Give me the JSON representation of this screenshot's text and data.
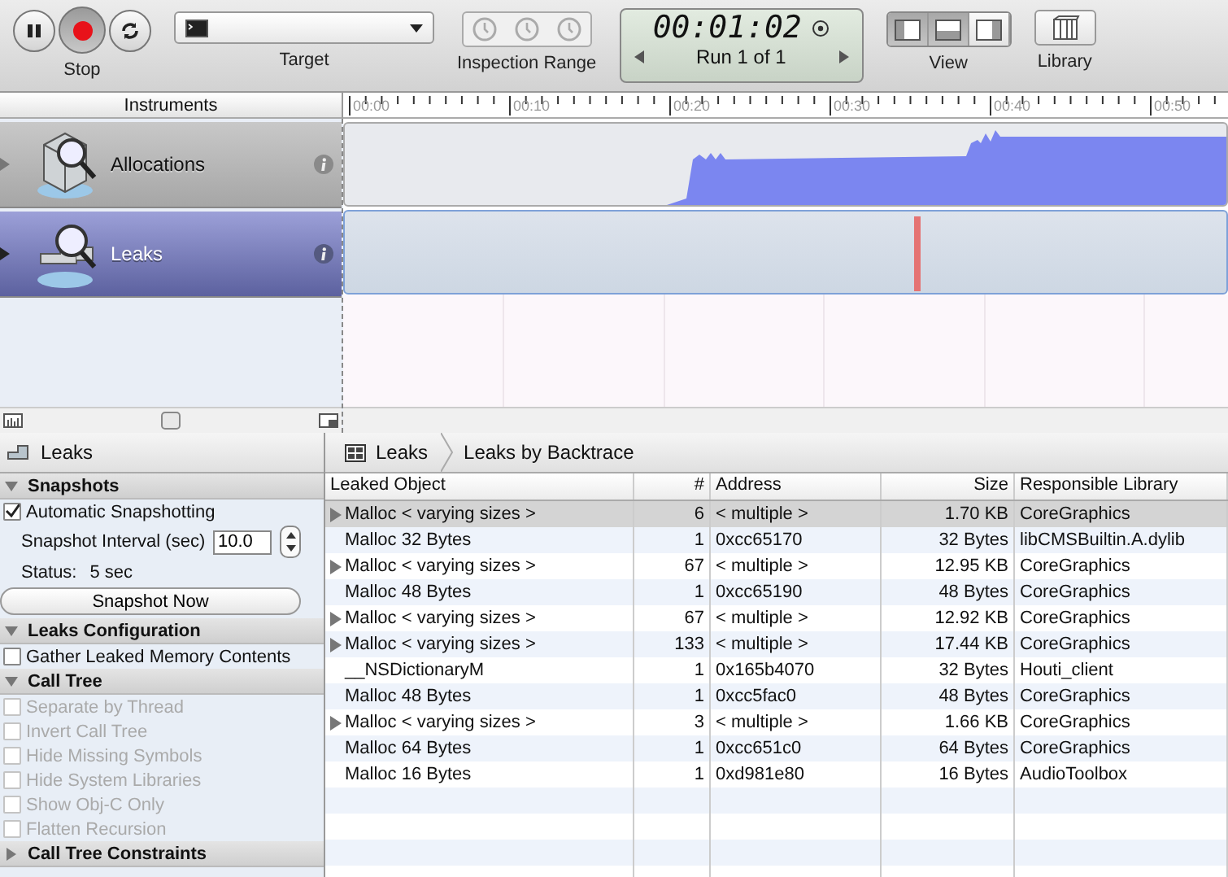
{
  "toolbar": {
    "record": {
      "label": "Stop",
      "recording": true
    },
    "target": {
      "label": "Target"
    },
    "inspection": {
      "label": "Inspection Range"
    },
    "timer": {
      "time": "00:01:02",
      "run": "Run 1 of 1"
    },
    "view": {
      "label": "View",
      "buttons": [
        {
          "selected": true
        },
        {
          "selected": true
        },
        {
          "selected": false
        }
      ]
    },
    "library": {
      "label": "Library"
    }
  },
  "timeline": {
    "header": "Instruments",
    "ruler": [
      "00:00",
      "00:10",
      "00:20",
      "00:30",
      "00:40",
      "00:50"
    ],
    "tracks": [
      {
        "name": "Allocations",
        "kind": "allocations",
        "selected": false
      },
      {
        "name": "Leaks",
        "kind": "leaks",
        "selected": true
      }
    ]
  },
  "detail": {
    "title": "Leaks",
    "breadcrumbs": [
      "Leaks",
      "Leaks by Backtrace"
    ]
  },
  "sections": [
    {
      "title": "Snapshots",
      "expanded": true,
      "items": [
        {
          "kind": "checkbox",
          "label": "Automatic Snapshotting",
          "checked": true,
          "disabled": false
        },
        {
          "kind": "number",
          "label": "Snapshot Interval (sec)",
          "value": "10.0"
        },
        {
          "kind": "status",
          "label": "Status:",
          "value": "5 sec"
        },
        {
          "kind": "button",
          "label": "Snapshot Now"
        }
      ]
    },
    {
      "title": "Leaks Configuration",
      "expanded": true,
      "items": [
        {
          "kind": "checkbox",
          "label": "Gather Leaked Memory Contents",
          "checked": false,
          "disabled": false
        }
      ]
    },
    {
      "title": "Call Tree",
      "expanded": true,
      "items": [
        {
          "kind": "checkbox",
          "label": "Separate by Thread",
          "checked": false,
          "disabled": true
        },
        {
          "kind": "checkbox",
          "label": "Invert Call Tree",
          "checked": false,
          "disabled": true
        },
        {
          "kind": "checkbox",
          "label": "Hide Missing Symbols",
          "checked": false,
          "disabled": true
        },
        {
          "kind": "checkbox",
          "label": "Hide System Libraries",
          "checked": false,
          "disabled": true
        },
        {
          "kind": "checkbox",
          "label": "Show Obj-C Only",
          "checked": false,
          "disabled": true
        },
        {
          "kind": "checkbox",
          "label": "Flatten Recursion",
          "checked": false,
          "disabled": true
        }
      ]
    },
    {
      "title": "Call Tree Constraints",
      "expanded": false
    }
  ],
  "table": {
    "columns": [
      "Leaked Object",
      "#",
      "Address",
      "Size",
      "Responsible Library"
    ],
    "rows": [
      {
        "cells": [
          "Malloc < varying sizes >",
          "6",
          "< multiple >",
          "1.70 KB",
          "CoreGraphics"
        ],
        "expandable": true,
        "selected": true
      },
      {
        "cells": [
          "Malloc 32 Bytes",
          "1",
          "0xcc65170",
          "32 Bytes",
          "libCMSBuiltin.A.dylib"
        ],
        "expandable": false,
        "selected": false
      },
      {
        "cells": [
          "Malloc < varying sizes >",
          "67",
          "< multiple >",
          "12.95 KB",
          "CoreGraphics"
        ],
        "expandable": true,
        "selected": false
      },
      {
        "cells": [
          "Malloc 48 Bytes",
          "1",
          "0xcc65190",
          "48 Bytes",
          "CoreGraphics"
        ],
        "expandable": false,
        "selected": false
      },
      {
        "cells": [
          "Malloc < varying sizes >",
          "67",
          "< multiple >",
          "12.92 KB",
          "CoreGraphics"
        ],
        "expandable": true,
        "selected": false
      },
      {
        "cells": [
          "Malloc < varying sizes >",
          "133",
          "< multiple >",
          "17.44 KB",
          "CoreGraphics"
        ],
        "expandable": true,
        "selected": false
      },
      {
        "cells": [
          "__NSDictionaryM",
          "1",
          "0x165b4070",
          "32 Bytes",
          "Houti_client"
        ],
        "expandable": false,
        "selected": false
      },
      {
        "cells": [
          "Malloc 48 Bytes",
          "1",
          "0xcc5fac0",
          "48 Bytes",
          "CoreGraphics"
        ],
        "expandable": false,
        "selected": false
      },
      {
        "cells": [
          "Malloc < varying sizes >",
          "3",
          "< multiple >",
          "1.66 KB",
          "CoreGraphics"
        ],
        "expandable": true,
        "selected": false
      },
      {
        "cells": [
          "Malloc 64 Bytes",
          "1",
          "0xcc651c0",
          "64 Bytes",
          "CoreGraphics"
        ],
        "expandable": false,
        "selected": false
      },
      {
        "cells": [
          "Malloc 16 Bytes",
          "1",
          "0xd981e80",
          "16 Bytes",
          "AudioToolbox"
        ],
        "expandable": false,
        "selected": false
      }
    ]
  }
}
